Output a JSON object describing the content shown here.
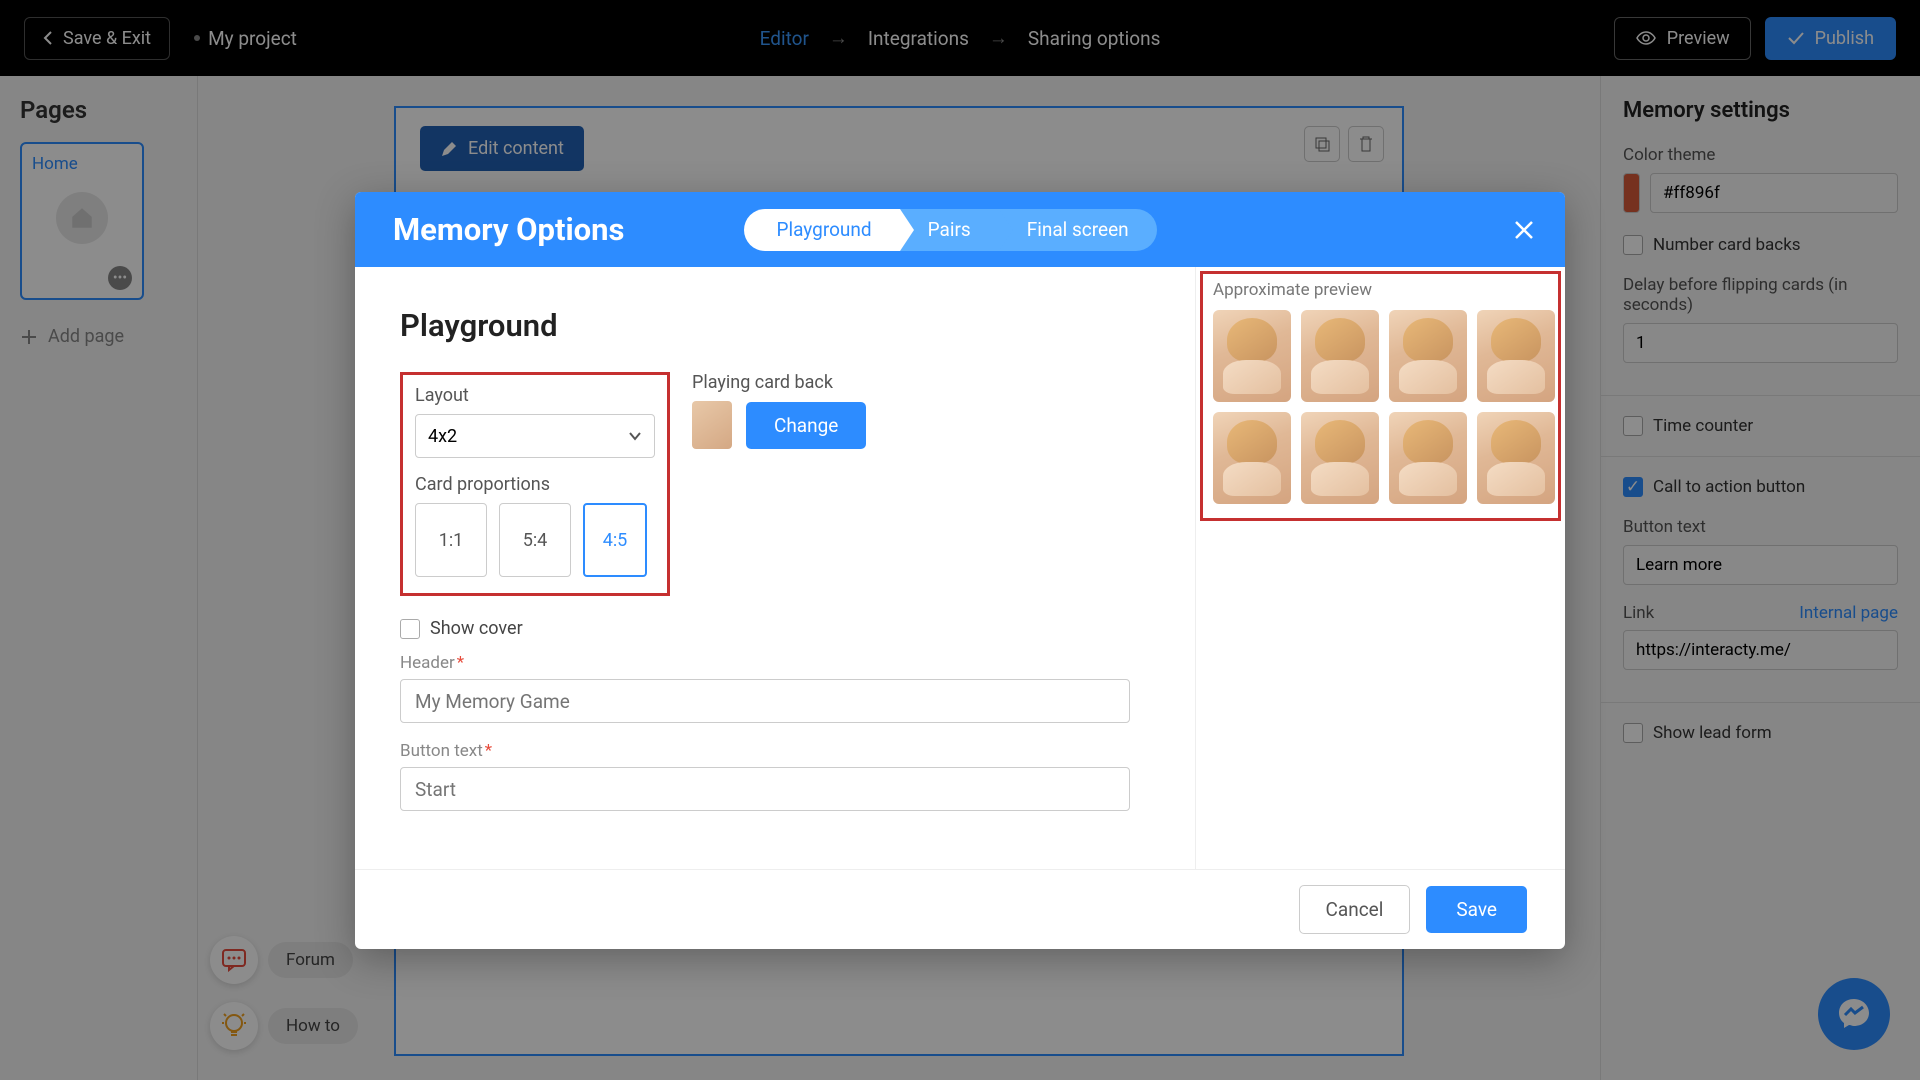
{
  "topbar": {
    "save_exit": "Save & Exit",
    "project": "My project",
    "nav": {
      "editor": "Editor",
      "integrations": "Integrations",
      "sharing": "Sharing options"
    },
    "preview": "Preview",
    "publish": "Publish"
  },
  "left": {
    "pages_title": "Pages",
    "home_label": "Home",
    "add_page": "Add page"
  },
  "canvas": {
    "edit_content": "Edit content"
  },
  "right": {
    "title": "Memory settings",
    "color_theme_label": "Color theme",
    "color_value": "#ff896f",
    "number_card_backs": "Number card backs",
    "delay_label": "Delay before flipping cards (in seconds)",
    "delay_value": "1",
    "time_counter": "Time counter",
    "cta_button": "Call to action button",
    "button_text_label": "Button text",
    "button_text_value": "Learn more",
    "link_label": "Link",
    "internal_page": "Internal page",
    "link_value": "https://interacty.me/",
    "show_lead_form": "Show lead form"
  },
  "help": {
    "forum": "Forum",
    "howto": "How to"
  },
  "modal": {
    "title": "Memory Options",
    "tabs": {
      "playground": "Playground",
      "pairs": "Pairs",
      "final": "Final screen"
    },
    "section_title": "Playground",
    "layout_label": "Layout",
    "layout_value": "4x2",
    "proportions_label": "Card proportions",
    "proportions": [
      "1:1",
      "5:4",
      "4:5"
    ],
    "card_back_label": "Playing card back",
    "change": "Change",
    "show_cover": "Show cover",
    "header_label": "Header",
    "header_placeholder": "My Memory Game",
    "button_text_label": "Button text",
    "button_text_placeholder": "Start",
    "preview_label": "Approximate preview",
    "cancel": "Cancel",
    "save": "Save"
  }
}
